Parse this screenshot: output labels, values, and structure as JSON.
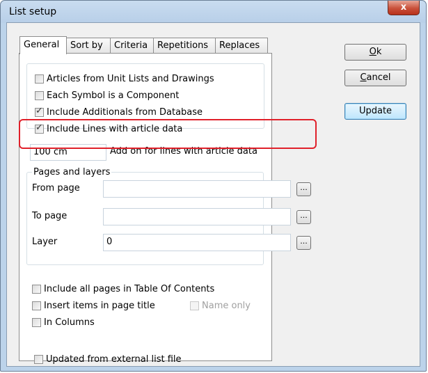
{
  "window": {
    "title": "List setup",
    "close_glyph": "x"
  },
  "tabs": [
    "General",
    "Sort by",
    "Criteria",
    "Repetitions",
    "Replaces"
  ],
  "options": [
    {
      "label": "Articles from Unit Lists and Drawings",
      "checked": false
    },
    {
      "label": "Each Symbol is a Component",
      "checked": false
    },
    {
      "label": "Include Additionals from Database",
      "checked": true
    },
    {
      "label": "Include Lines with article data",
      "checked": true
    }
  ],
  "addon": {
    "value": "100 cm",
    "label": "Add on for lines with article data"
  },
  "pages_group": {
    "title": "Pages and layers",
    "from_label": "From page",
    "from_value": "",
    "to_label": "To page",
    "to_value": "",
    "layer_label": "Layer",
    "layer_value": "0",
    "browse_label": "..."
  },
  "lower_options": {
    "toc": "Include all pages in Table Of Contents",
    "insert_title": "Insert items in page title",
    "name_only": "Name only",
    "in_columns": "In Columns"
  },
  "footer_option": "Updated from external list file",
  "buttons": {
    "ok_mnemonic": "O",
    "ok_rest": "k",
    "cancel_mnemonic": "C",
    "cancel_rest": "ancel",
    "update": "Update"
  }
}
